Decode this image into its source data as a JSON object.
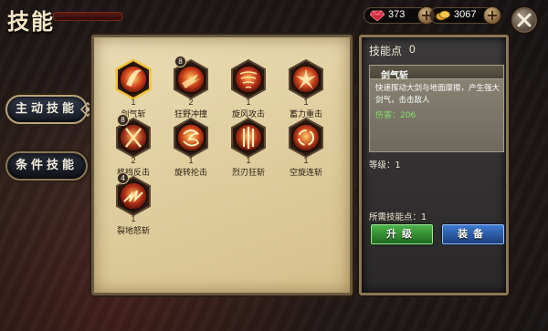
{
  "header": {
    "title": "技能",
    "gems": "373",
    "gold": "3067",
    "gem_icon": "red-gem-icon",
    "gold_icon": "gold-coin-icon"
  },
  "tabs": [
    {
      "label": "主动技能",
      "active": true
    },
    {
      "label": "条件技能",
      "active": false
    }
  ],
  "skills": [
    {
      "name": "剑气斩",
      "level": "1",
      "badge": "",
      "selected": true,
      "icon": "sword-slash-icon"
    },
    {
      "name": "狂野冲撞",
      "level": "2",
      "badge": "8",
      "selected": false,
      "icon": "rush-icon"
    },
    {
      "name": "旋风攻击",
      "level": "1",
      "badge": "",
      "selected": false,
      "icon": "whirlwind-icon"
    },
    {
      "name": "蓄力重击",
      "level": "1",
      "badge": "",
      "selected": false,
      "icon": "charge-smash-icon"
    },
    {
      "name": "格挡反击",
      "level": "2",
      "badge": "8",
      "selected": false,
      "icon": "parry-icon"
    },
    {
      "name": "旋转抡击",
      "level": "1",
      "badge": "",
      "selected": false,
      "icon": "spin-strike-icon"
    },
    {
      "name": "烈刃狂斩",
      "level": "1",
      "badge": "",
      "selected": false,
      "icon": "fierce-blade-icon"
    },
    {
      "name": "空旋连斩",
      "level": "1",
      "badge": "",
      "selected": false,
      "icon": "air-spin-icon"
    },
    {
      "name": "裂地怒斩",
      "level": "1",
      "badge": "4",
      "selected": false,
      "icon": "ground-split-icon"
    }
  ],
  "detail": {
    "points_label": "技能点",
    "points": "0",
    "skill_name": "剑气斩",
    "description": "快速挥动大剑与地面摩擦，产生强大剑气，击击敌人",
    "damage": "伤害：206",
    "level_text": "等级：1",
    "required_text": "所需技能点：1",
    "upgrade_label": "升级",
    "equip_label": "装备"
  },
  "colors": {
    "selected_glow": "#f2c230",
    "upgrade_green": "#3a9a3a",
    "equip_blue": "#2a5aa8",
    "damage_green": "#7fe06a"
  }
}
